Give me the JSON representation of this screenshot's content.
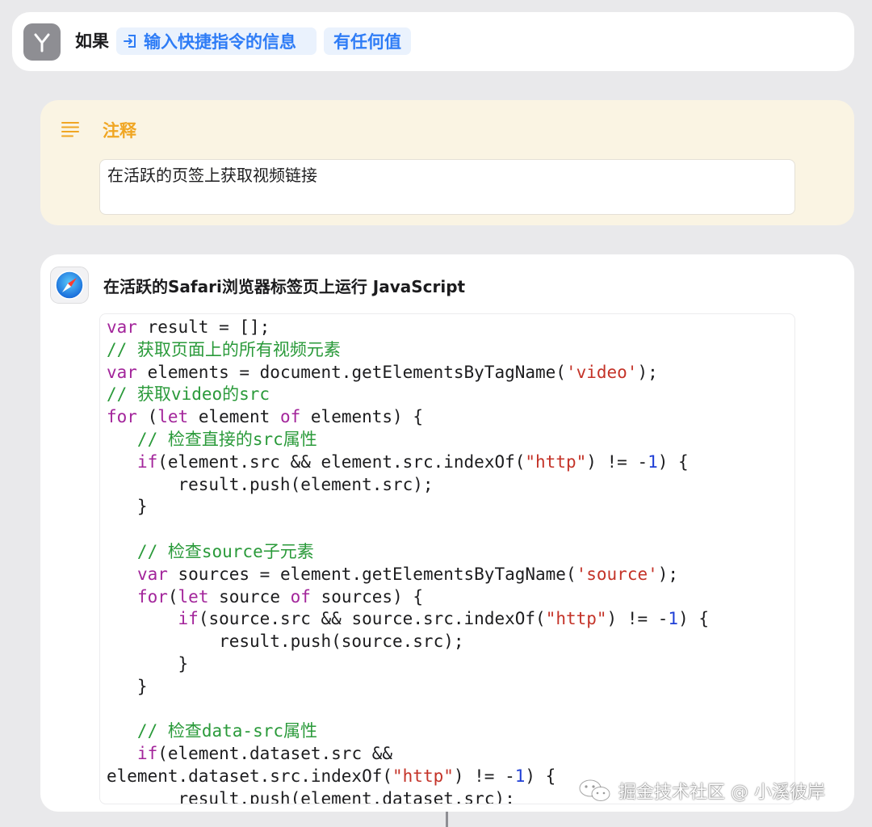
{
  "if_action": {
    "label": "如果",
    "input_token": "输入快捷指令的信息",
    "condition_token": "有任何值",
    "icon": "branch-icon"
  },
  "comment_action": {
    "title": "注释",
    "text": "在活跃的页签上获取视频链接",
    "icon": "text-lines-icon",
    "accent": "#f0a623"
  },
  "js_action": {
    "title": "在活跃的Safari浏览器标签页上运行 JavaScript",
    "icon": "safari-compass-icon"
  },
  "code": [
    [
      {
        "t": "var",
        "c": "kw"
      },
      {
        "t": " result = [];",
        "c": ""
      }
    ],
    [
      {
        "t": "// 获取页面上的所有视频元素",
        "c": "cm"
      }
    ],
    [
      {
        "t": "var",
        "c": "kw"
      },
      {
        "t": " elements = document.getElementsByTagName(",
        "c": ""
      },
      {
        "t": "'video'",
        "c": "str"
      },
      {
        "t": ");",
        "c": ""
      }
    ],
    [
      {
        "t": "// 获取video的src",
        "c": "cm"
      }
    ],
    [
      {
        "t": "for",
        "c": "kw"
      },
      {
        "t": " (",
        "c": ""
      },
      {
        "t": "let",
        "c": "kw"
      },
      {
        "t": " element ",
        "c": ""
      },
      {
        "t": "of",
        "c": "kw"
      },
      {
        "t": " elements) {",
        "c": ""
      }
    ],
    [
      {
        "t": "   // 检查直接的src属性",
        "c": "cm"
      }
    ],
    [
      {
        "t": "   ",
        "c": ""
      },
      {
        "t": "if",
        "c": "kw"
      },
      {
        "t": "(element.src && element.src.indexOf(",
        "c": ""
      },
      {
        "t": "\"http\"",
        "c": "str"
      },
      {
        "t": ") != -",
        "c": ""
      },
      {
        "t": "1",
        "c": "num"
      },
      {
        "t": ") {",
        "c": ""
      }
    ],
    [
      {
        "t": "       result.push(element.src);",
        "c": ""
      }
    ],
    [
      {
        "t": "   }",
        "c": ""
      }
    ],
    [],
    [
      {
        "t": "   // 检查source子元素",
        "c": "cm"
      }
    ],
    [
      {
        "t": "   ",
        "c": ""
      },
      {
        "t": "var",
        "c": "kw"
      },
      {
        "t": " sources = element.getElementsByTagName(",
        "c": ""
      },
      {
        "t": "'source'",
        "c": "str"
      },
      {
        "t": ");",
        "c": ""
      }
    ],
    [
      {
        "t": "   ",
        "c": ""
      },
      {
        "t": "for",
        "c": "kw"
      },
      {
        "t": "(",
        "c": ""
      },
      {
        "t": "let",
        "c": "kw"
      },
      {
        "t": " source ",
        "c": ""
      },
      {
        "t": "of",
        "c": "kw"
      },
      {
        "t": " sources) {",
        "c": ""
      }
    ],
    [
      {
        "t": "       ",
        "c": ""
      },
      {
        "t": "if",
        "c": "kw"
      },
      {
        "t": "(source.src && source.src.indexOf(",
        "c": ""
      },
      {
        "t": "\"http\"",
        "c": "str"
      },
      {
        "t": ") != -",
        "c": ""
      },
      {
        "t": "1",
        "c": "num"
      },
      {
        "t": ") {",
        "c": ""
      }
    ],
    [
      {
        "t": "           result.push(source.src);",
        "c": ""
      }
    ],
    [
      {
        "t": "       }",
        "c": ""
      }
    ],
    [
      {
        "t": "   }",
        "c": ""
      }
    ],
    [],
    [
      {
        "t": "   // 检查data-src属性",
        "c": "cm"
      }
    ],
    [
      {
        "t": "   ",
        "c": ""
      },
      {
        "t": "if",
        "c": "kw"
      },
      {
        "t": "(element.dataset.src &&",
        "c": ""
      }
    ],
    [
      {
        "t": "element.dataset.src.indexOf(",
        "c": ""
      },
      {
        "t": "\"http\"",
        "c": "str"
      },
      {
        "t": ") != -",
        "c": ""
      },
      {
        "t": "1",
        "c": "num"
      },
      {
        "t": ") {",
        "c": ""
      }
    ],
    [
      {
        "t": "       result.push(element.dataset.src);",
        "c": ""
      }
    ]
  ],
  "watermark": {
    "text": "掘金技术社区 @ 小溪彼岸",
    "icon": "wechat-icon"
  },
  "colors": {
    "keyword": "#a3259b",
    "comment": "#2a9a3a",
    "string": "#c43328",
    "number": "#1f3fd6",
    "token_blue": "#2e7cf6"
  }
}
